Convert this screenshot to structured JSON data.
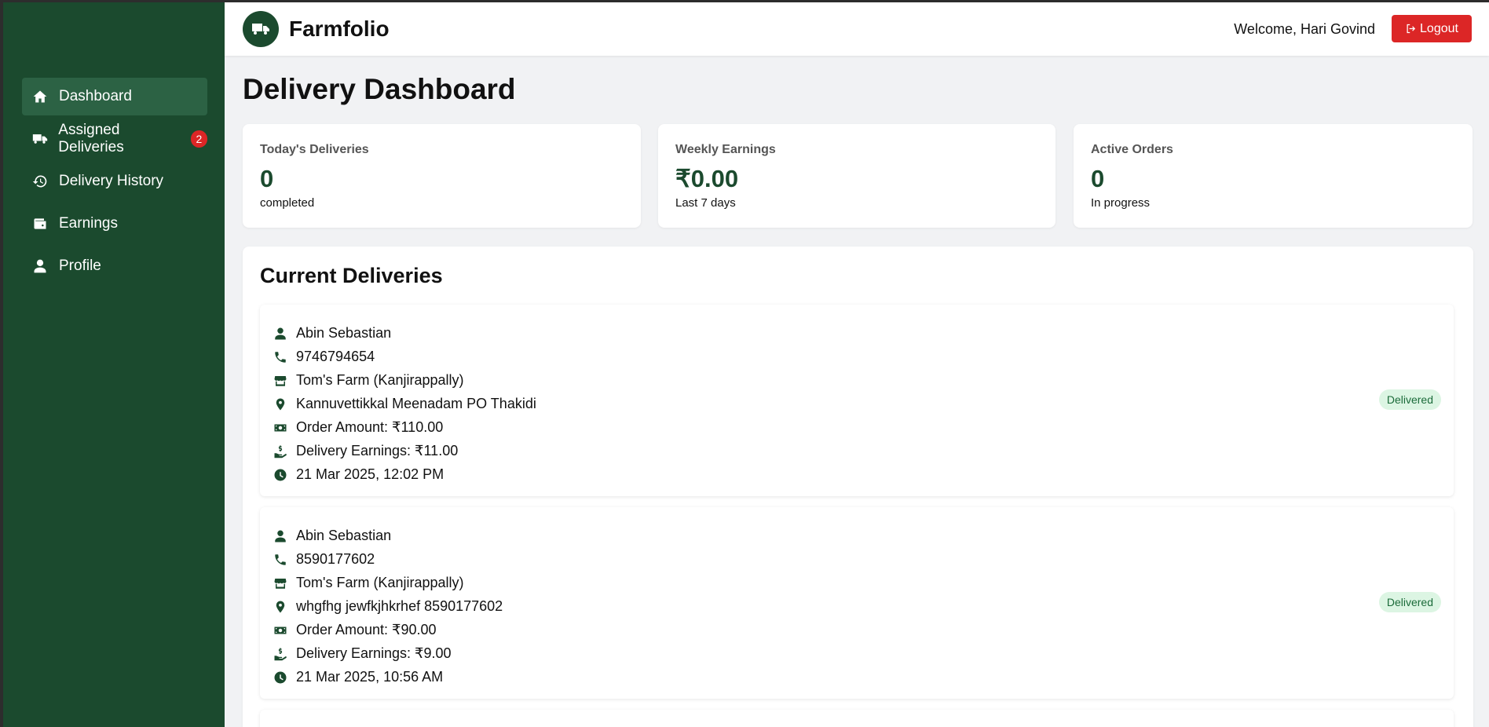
{
  "app": {
    "brand": "Farmfolio"
  },
  "header": {
    "welcome": "Welcome, Hari Govind",
    "logout_label": "Logout"
  },
  "sidebar": {
    "items": [
      {
        "label": "Dashboard",
        "icon": "home-icon",
        "active": true
      },
      {
        "label": "Assigned Deliveries",
        "icon": "truck-icon",
        "badge": "2"
      },
      {
        "label": "Delivery History",
        "icon": "history-icon"
      },
      {
        "label": "Earnings",
        "icon": "wallet-icon"
      },
      {
        "label": "Profile",
        "icon": "user-icon"
      }
    ]
  },
  "page": {
    "title": "Delivery Dashboard"
  },
  "stats": [
    {
      "label": "Today's Deliveries",
      "value": "0",
      "sub": "completed"
    },
    {
      "label": "Weekly Earnings",
      "value": "₹0.00",
      "sub": "Last 7 days"
    },
    {
      "label": "Active Orders",
      "value": "0",
      "sub": "In progress"
    }
  ],
  "deliveries": {
    "title": "Current Deliveries",
    "items": [
      {
        "customer": "Abin Sebastian",
        "phone": "9746794654",
        "farm": "Tom's Farm (Kanjirappally)",
        "address": "Kannuvettikkal Meenadam PO Thakidi",
        "order_amount": "Order Amount: ₹110.00",
        "earnings": "Delivery Earnings: ₹11.00",
        "time": "21 Mar 2025, 12:02 PM",
        "status": "Delivered"
      },
      {
        "customer": "Abin Sebastian",
        "phone": "8590177602",
        "farm": "Tom's Farm (Kanjirappally)",
        "address": "whgfhg jewfkjhkrhef 8590177602",
        "order_amount": "Order Amount: ₹90.00",
        "earnings": "Delivery Earnings: ₹9.00",
        "time": "21 Mar 2025, 10:56 AM",
        "status": "Delivered"
      }
    ]
  },
  "colors": {
    "sidebar_bg": "#1b4a2e",
    "sidebar_active": "#2c6244",
    "accent_green": "#1b4a2e",
    "logout_red": "#dc2626",
    "status_bg": "#dcf5e3",
    "status_text": "#1b6b3a"
  }
}
